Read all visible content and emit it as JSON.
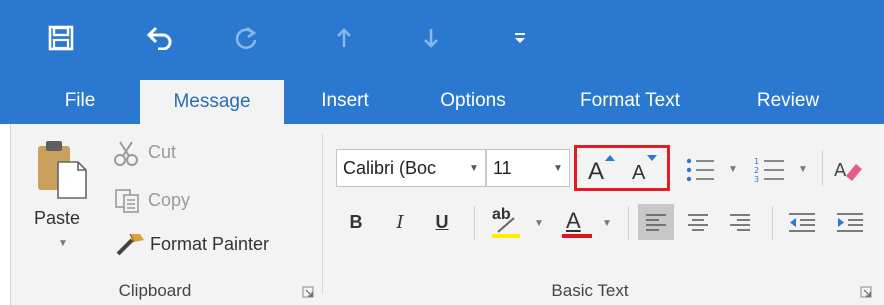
{
  "quick_access": {
    "icons": [
      "save-icon",
      "undo-icon",
      "redo-icon",
      "up-arrow-icon",
      "down-arrow-icon",
      "customize-qat-icon"
    ]
  },
  "tabs": [
    {
      "label": "File",
      "active": false
    },
    {
      "label": "Message",
      "active": true
    },
    {
      "label": "Insert",
      "active": false
    },
    {
      "label": "Options",
      "active": false
    },
    {
      "label": "Format Text",
      "active": false
    },
    {
      "label": "Review",
      "active": false
    }
  ],
  "clipboard": {
    "paste_label": "Paste",
    "cut_label": "Cut",
    "copy_label": "Copy",
    "format_painter_label": "Format Painter",
    "group_label": "Clipboard"
  },
  "basic_text": {
    "font_name": "Calibri (Boc",
    "font_size": "11",
    "grow_font_glyph": "A",
    "shrink_font_glyph": "A",
    "bold_glyph": "B",
    "italic_glyph": "I",
    "underline_glyph": "U",
    "highlight_glyph": "ab",
    "font_color_glyph": "A",
    "group_label": "Basic Text"
  },
  "colors": {
    "accent": "#2b78d0",
    "active_tab_text": "#2b6cb9",
    "ribbon_bg": "#f3f3f3",
    "highlight_box": "#e31c23",
    "highlight_color": "#ffee00",
    "font_color": "#e0141e"
  }
}
